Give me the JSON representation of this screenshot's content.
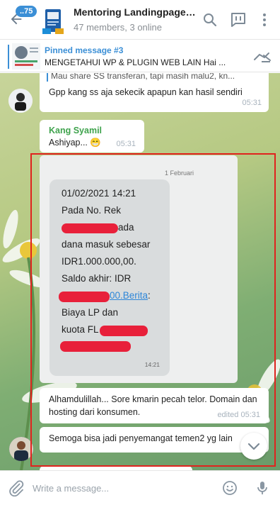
{
  "header": {
    "unread_count": "..75",
    "title": "Mentoring Landingpage S...",
    "subtitle": "47 members, 3 online"
  },
  "pinned": {
    "title": "Pinned message #3",
    "text": "MENGETAHUI WP & PLUGIN WEB LAIN  Hai ..."
  },
  "messages": {
    "m1": {
      "reply_text": "Mau share SS transferan, tapi masih malu2, kn...",
      "text": "Gpp kang ss aja sekecik apapun kan hasil sendiri",
      "time": "05:31"
    },
    "m2": {
      "sender": "Kang Syamil",
      "text": "Ashiyap... 😁",
      "time": "05:31"
    },
    "m3": {
      "date": "1 Februari",
      "sms_datetime": "01/02/2021 14:21",
      "sms_line1": "Pada No. Rek",
      "sms_line2": "ada",
      "sms_line3": "dana masuk sebesar",
      "sms_line4": "IDR1.000.000,00.",
      "sms_line5": "Saldo akhir: IDR",
      "sms_link": "00.Berita",
      "sms_colon": ":",
      "sms_line6": "Biaya LP dan",
      "sms_line7": "kuota FL",
      "sms_time": "14:21"
    },
    "m4": {
      "text": "Alhamdulillah... Sore kmarin pecah telor. Domain dan hosting dari konsumen.",
      "time": "edited 05:31"
    },
    "m5": {
      "text": "Semoga bisa jadi penyemangat temen2 yg lain"
    }
  },
  "input": {
    "placeholder": "Write a message..."
  },
  "colors": {
    "accent": "#3b8fd6",
    "sender_name": "#3fa34d",
    "highlight": "#e0231e",
    "redaction": "#e8203a"
  }
}
